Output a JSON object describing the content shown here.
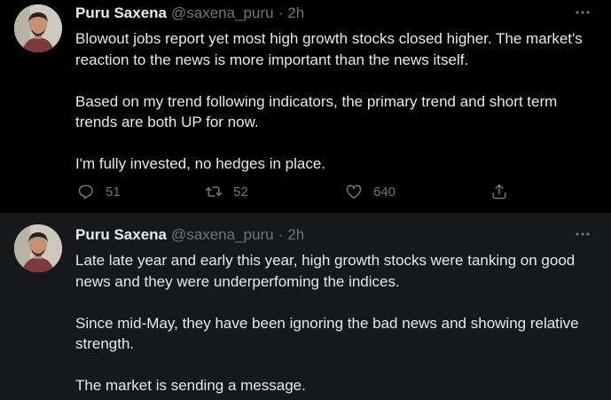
{
  "tweets": [
    {
      "author_name": "Puru Saxena",
      "handle": "@saxena_puru",
      "separator": "·",
      "time": "2h",
      "paragraphs": [
        "Blowout jobs report yet most high growth stocks closed higher. The market's reaction to the news is more important than the news itself.",
        "Based on my trend following indicators, the primary trend and short term trends are both UP for now.",
        "I'm fully invested, no hedges in place."
      ],
      "replies": "51",
      "retweets": "52",
      "likes": "640"
    },
    {
      "author_name": "Puru Saxena",
      "handle": "@saxena_puru",
      "separator": "·",
      "time": "2h",
      "paragraphs": [
        "Late late year and early this year, high growth stocks were tanking on good news and they were underperfoming the indices.",
        "Since mid-May, they have been ignoring the bad news and showing relative strength.",
        "The market is sending a message."
      ]
    }
  ],
  "icons": {
    "more": "more-icon",
    "reply": "reply-icon",
    "retweet": "retweet-icon",
    "like": "heart-icon",
    "share": "share-icon"
  },
  "colors": {
    "background": "#000000",
    "second_tweet_background": "#16181c",
    "text": "#e7e9ea",
    "muted": "#71767b",
    "thread_line": "#3e4144"
  }
}
